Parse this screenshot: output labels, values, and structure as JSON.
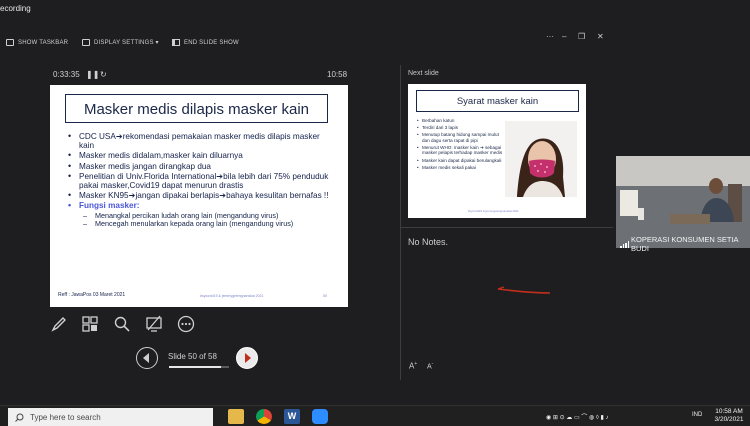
{
  "recording": {
    "label": "ecording"
  },
  "toolbar": {
    "show_taskbar": "SHOW TASKBAR",
    "display_settings": "DISPLAY SETTINGS ▾",
    "end_slide_show": "END SLIDE SHOW"
  },
  "presenter": {
    "elapsed": "0:33:35",
    "clock": "10:58"
  },
  "current_slide": {
    "title": "Masker medis dilapis masker kain",
    "bullets": [
      "CDC USA➔rekomendasi pemakaian masker medis dilapis masker kain",
      "Masker medis didalam,masker kain diluarnya",
      "Masker medis jangan dirangkap dua",
      "Penelitian di Univ.Florida International➔bila lebih dari 75% penduduk pakai masker,Covid19 dapat menurun drastis",
      "Masker KN95➔jangan dipakai berlapis➔bahaya kesulitan bernafas !!"
    ],
    "fungsi_title": "Fungsi masker:",
    "sub_bullets": [
      "Menangkal percikan ludah orang lain (mengandung virus)",
      "Mencegah menularkan kepada orang lain (mengandung virus)"
    ],
    "reff": "Reff : JawaPos 03 Maret 2021",
    "footer_note": "#sycovid19 & jemmygelengnanskal 2021",
    "slide_number": "50"
  },
  "navigation": {
    "label": "Slide 50 of 58",
    "progress": 0.862
  },
  "next_slide": {
    "label": "Next slide",
    "title": "Syarat masker kain",
    "items": [
      "Berbahan katun",
      "Terdiri dari 3 lapis",
      "Menutup batang hidung sampai mulut dan dagu serta rapat di pipi",
      "Menurut WHO: masker kain ➔ sebagai masker pelapis terhadap masker medis",
      "Masker kain dapat dipakai berulangkali",
      "Masker medis sekali pakai"
    ],
    "footer": "#sycovid19 & jemmygelengnanskal 2021"
  },
  "notes": {
    "text": "No Notes."
  },
  "video": {
    "participant": "KOPERASI KONSUMEN SETIA BUDI"
  },
  "taskbar": {
    "search_placeholder": "Type here to search",
    "lang": "IND",
    "time": "10:58 AM",
    "date": "3/20/2021"
  },
  "colors": {
    "accent_red": "#c22e1d",
    "slide_navy": "#1b2748",
    "fungsi_blue": "#4a57d9"
  }
}
